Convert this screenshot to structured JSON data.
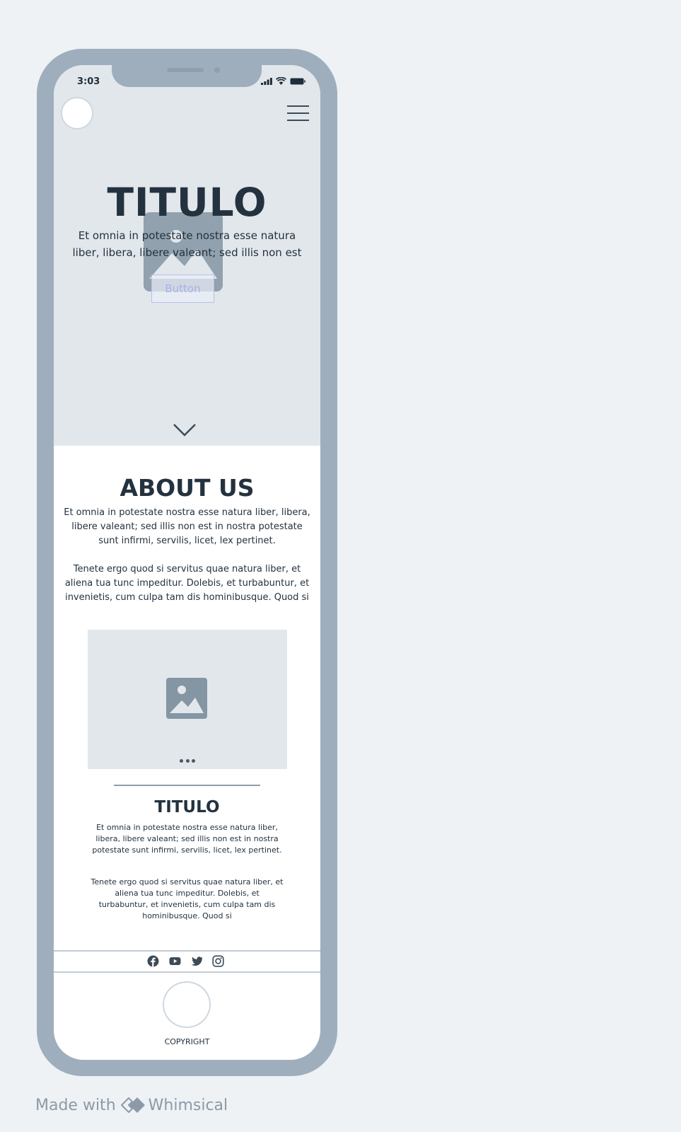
{
  "status_bar": {
    "time": "3:03"
  },
  "hero": {
    "title": "TITULO",
    "text": "Et omnia in potestate nostra esse natura liber, libera, libere valeant; sed illis non est",
    "button_label": "Button"
  },
  "about": {
    "title": "ABOUT US",
    "paragraph_1": "Et omnia in potestate nostra esse natura liber, libera, libere valeant; sed illis non est in nostra potestate sunt infirmi, servilis, licet, lex pertinet.",
    "paragraph_2": "Tenete ergo quod si servitus quae natura liber, et aliena tua tunc impeditur. Dolebis, et turbabuntur, et invenietis, cum culpa tam dis hominibusque. Quod si"
  },
  "card": {
    "title": "TITULO",
    "paragraph_1": "Et omnia in potestate nostra esse natura liber, libera, libere valeant; sed illis non est in nostra potestate sunt infirmi, servilis, licet, lex pertinet.",
    "paragraph_2": "Tenete ergo quod si servitus quae natura liber, et aliena tua tunc impeditur. Dolebis, et turbabuntur, et invenietis, cum culpa tam dis hominibusque. Quod si"
  },
  "footer": {
    "social_icons": [
      "facebook-icon",
      "youtube-icon",
      "twitter-icon",
      "instagram-icon"
    ],
    "copyright": "COPYRIGHT"
  },
  "watermark": {
    "prefix": "Made with",
    "brand": "Whimsical"
  },
  "colors": {
    "page_background": "#eef2f5",
    "phone_frame": "#9eaebd",
    "hero_background": "#e2e7ec",
    "text": "#24323f",
    "button_border": "#b9c0e6"
  }
}
